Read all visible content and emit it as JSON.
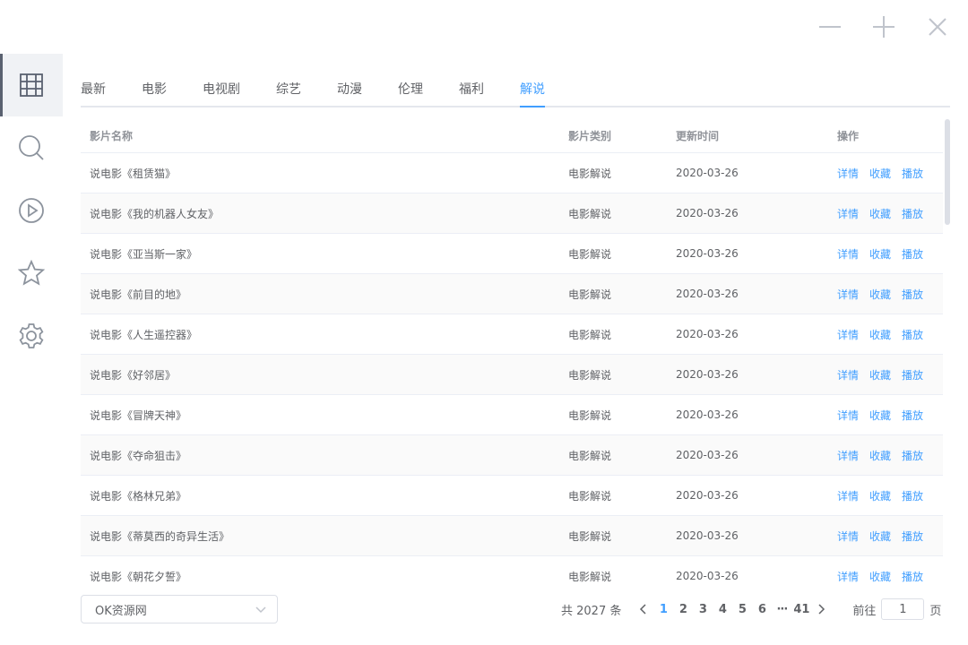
{
  "window_controls": {
    "minimize_icon": "minus-icon",
    "maximize_icon": "plus-icon",
    "close_icon": "close-icon"
  },
  "sidebar": {
    "items": [
      {
        "name": "grid-icon",
        "active": true
      },
      {
        "name": "search-icon",
        "active": false
      },
      {
        "name": "play-circle-icon",
        "active": false
      },
      {
        "name": "star-icon",
        "active": false
      },
      {
        "name": "gear-icon",
        "active": false
      }
    ]
  },
  "tabs": [
    {
      "label": "最新"
    },
    {
      "label": "电影"
    },
    {
      "label": "电视剧"
    },
    {
      "label": "综艺"
    },
    {
      "label": "动漫"
    },
    {
      "label": "伦理"
    },
    {
      "label": "福利"
    },
    {
      "label": "解说",
      "active": true
    }
  ],
  "table": {
    "headers": {
      "name": "影片名称",
      "type": "影片类别",
      "updated": "更新时间",
      "ops": "操作"
    },
    "op_labels": {
      "detail": "详情",
      "favorite": "收藏",
      "play": "播放"
    },
    "rows": [
      {
        "name": "说电影《租赁猫》",
        "type": "电影解说",
        "updated": "2020-03-26"
      },
      {
        "name": "说电影《我的机器人女友》",
        "type": "电影解说",
        "updated": "2020-03-26"
      },
      {
        "name": "说电影《亚当斯一家》",
        "type": "电影解说",
        "updated": "2020-03-26"
      },
      {
        "name": "说电影《前目的地》",
        "type": "电影解说",
        "updated": "2020-03-26"
      },
      {
        "name": "说电影《人生遥控器》",
        "type": "电影解说",
        "updated": "2020-03-26"
      },
      {
        "name": "说电影《好邻居》",
        "type": "电影解说",
        "updated": "2020-03-26"
      },
      {
        "name": "说电影《冒牌天神》",
        "type": "电影解说",
        "updated": "2020-03-26"
      },
      {
        "name": "说电影《夺命狙击》",
        "type": "电影解说",
        "updated": "2020-03-26"
      },
      {
        "name": "说电影《格林兄弟》",
        "type": "电影解说",
        "updated": "2020-03-26"
      },
      {
        "name": "说电影《蒂莫西的奇异生活》",
        "type": "电影解说",
        "updated": "2020-03-26"
      },
      {
        "name": "说电影《朝花夕誓》",
        "type": "电影解说",
        "updated": "2020-03-26"
      }
    ]
  },
  "source_select": {
    "value": "OK资源网"
  },
  "pagination": {
    "total_text": "共 2027 条",
    "pages": [
      "1",
      "2",
      "3",
      "4",
      "5",
      "6"
    ],
    "active_page": "1",
    "more": "···",
    "last_page": "41",
    "goto_label": "前往",
    "goto_value": "1",
    "page_suffix": "页"
  },
  "colors": {
    "accent": "#409eff",
    "text": "#606266",
    "header_text": "#909399",
    "border": "#ebeef5",
    "stripe": "#fafafa"
  }
}
